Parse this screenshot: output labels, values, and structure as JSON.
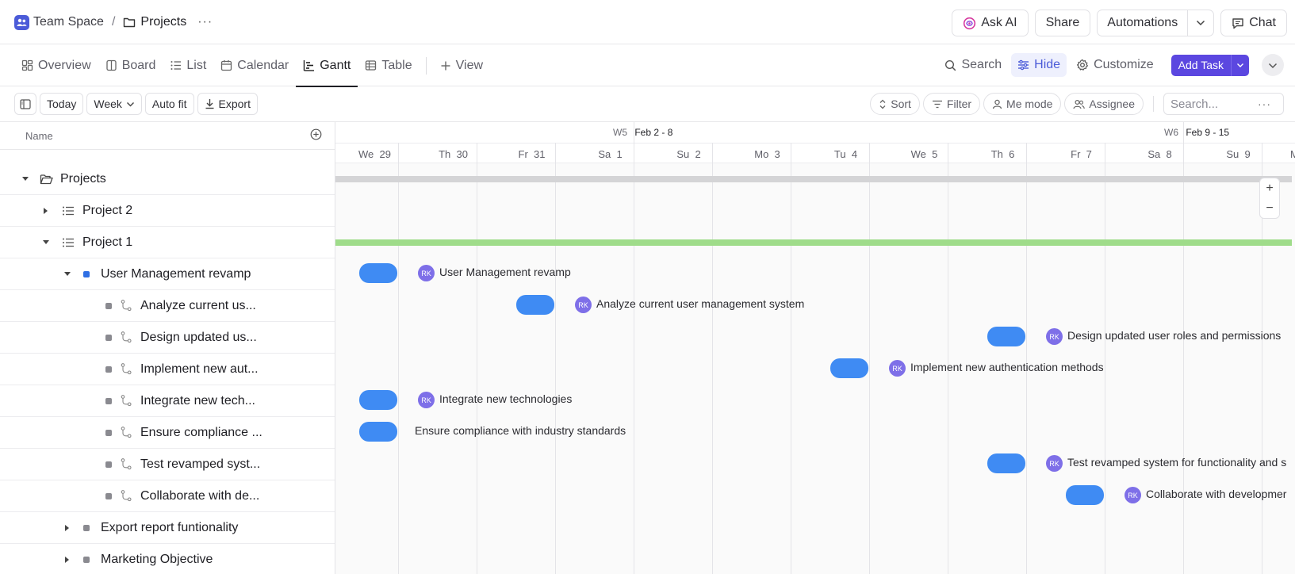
{
  "breadcrumb": {
    "space": "Team Space",
    "separator": "/",
    "current": "Projects",
    "more": "···"
  },
  "header_actions": {
    "ask_ai": "Ask AI",
    "share": "Share",
    "automations": "Automations",
    "chat": "Chat"
  },
  "tabs": [
    {
      "label": "Overview",
      "icon": "overview-icon"
    },
    {
      "label": "Board",
      "icon": "board-icon"
    },
    {
      "label": "List",
      "icon": "list-icon"
    },
    {
      "label": "Calendar",
      "icon": "calendar-icon"
    },
    {
      "label": "Gantt",
      "icon": "gantt-icon",
      "active": true
    },
    {
      "label": "Table",
      "icon": "table-icon"
    }
  ],
  "add_view": "View",
  "view_actions": {
    "search": "Search",
    "hide": "Hide",
    "customize": "Customize",
    "add_task": "Add Task"
  },
  "toolbar": {
    "today": "Today",
    "week": "Week",
    "autofit": "Auto fit",
    "export": "Export",
    "sort": "Sort",
    "filter": "Filter",
    "me_mode": "Me mode",
    "assignee": "Assignee",
    "search_placeholder": "Search...",
    "more": "···"
  },
  "tree": {
    "column_name": "Name",
    "rows": [
      {
        "label": "Projects",
        "type": "folder",
        "expanded": true
      },
      {
        "label": "Project 2",
        "type": "list",
        "expanded": false
      },
      {
        "label": "Project 1",
        "type": "list",
        "expanded": true
      },
      {
        "label": "User Management revamp",
        "type": "task",
        "expanded": true,
        "status_color": "#2f6fe4"
      },
      {
        "label": "Analyze current us...",
        "type": "subtask"
      },
      {
        "label": "Design updated us...",
        "type": "subtask"
      },
      {
        "label": "Implement new aut...",
        "type": "subtask"
      },
      {
        "label": "Integrate new tech...",
        "type": "subtask"
      },
      {
        "label": "Ensure compliance ...",
        "type": "subtask"
      },
      {
        "label": "Test revamped syst...",
        "type": "subtask"
      },
      {
        "label": "Collaborate with de...",
        "type": "subtask"
      },
      {
        "label": "Export report funtionality",
        "type": "task",
        "expanded": false
      },
      {
        "label": "Marketing Objective",
        "type": "task",
        "expanded": false
      }
    ]
  },
  "timeline": {
    "weeks": [
      {
        "num": "W5",
        "range": "Feb 2 - 8"
      },
      {
        "num": "W6",
        "range": "Feb 9 - 15"
      }
    ],
    "days": [
      {
        "dow": "We",
        "day": "29"
      },
      {
        "dow": "Th",
        "day": "30"
      },
      {
        "dow": "Fr",
        "day": "31"
      },
      {
        "dow": "Sa",
        "day": "1"
      },
      {
        "dow": "Su",
        "day": "2"
      },
      {
        "dow": "Mo",
        "day": "3"
      },
      {
        "dow": "Tu",
        "day": "4"
      },
      {
        "dow": "We",
        "day": "5"
      },
      {
        "dow": "Th",
        "day": "6"
      },
      {
        "dow": "Fr",
        "day": "7"
      },
      {
        "dow": "Sa",
        "day": "8"
      },
      {
        "dow": "Su",
        "day": "9"
      },
      {
        "dow": "M",
        "day": ""
      }
    ],
    "bars": [
      {
        "label": "User Management revamp",
        "avatar": "RK"
      },
      {
        "label": "Analyze current user management system",
        "avatar": "RK"
      },
      {
        "label": "Design updated user roles and permissions",
        "avatar": "RK"
      },
      {
        "label": "Implement new authentication methods",
        "avatar": "RK"
      },
      {
        "label": "Integrate new technologies",
        "avatar": "RK"
      },
      {
        "label": "Ensure compliance with industry standards",
        "avatar": ""
      },
      {
        "label": "Test revamped system for functionality and s",
        "avatar": "RK"
      },
      {
        "label": "Collaborate with developmer",
        "avatar": "RK"
      }
    ],
    "zoom_in": "+",
    "zoom_out": "−"
  },
  "colors": {
    "accent": "#5b47e0",
    "bar": "#3f8bf3",
    "project_bar": "#9fdc8a",
    "folder_bar": "#d4d4d6",
    "avatar": "#7e6fe8"
  }
}
